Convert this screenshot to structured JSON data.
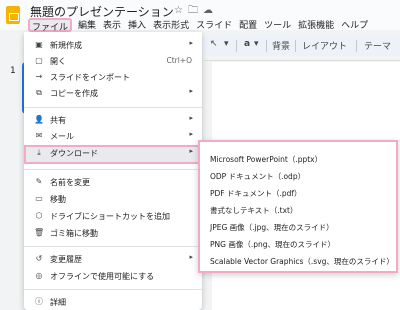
{
  "header": {
    "doc_title": "無題のプレゼンテーション",
    "icons": [
      "star-icon",
      "folder-icon",
      "cloud-icon"
    ]
  },
  "menubar": [
    "ファイル",
    "編集",
    "表示",
    "挿入",
    "表示形式",
    "スライド",
    "配置",
    "ツール",
    "拡張機能",
    "ヘルプ"
  ],
  "toolbar": {
    "shape_glyph": "↖",
    "text_glyph": "a",
    "background": "背景",
    "layout": "レイアウト",
    "theme": "テーマ"
  },
  "slides": {
    "number": "1"
  },
  "file_menu": {
    "items": [
      {
        "label": "新規作成",
        "icon": "new-icon",
        "glyph": "▣",
        "arrow": "▸"
      },
      {
        "label": "開く",
        "icon": "open-icon",
        "glyph": "▢",
        "shortcut": "Ctrl+O"
      },
      {
        "label": "スライドをインポート",
        "icon": "import-icon",
        "glyph": "→"
      },
      {
        "label": "コピーを作成",
        "icon": "copy-icon",
        "glyph": "⧉",
        "arrow": "▸"
      },
      {
        "label": "共有",
        "icon": "share-icon",
        "glyph": "👤",
        "arrow": "▸"
      },
      {
        "label": "メール",
        "icon": "mail-icon",
        "glyph": "✉",
        "arrow": "▸"
      },
      {
        "label": "ダウンロード",
        "icon": "download-icon",
        "glyph": "⤓",
        "arrow": "▸"
      },
      {
        "label": "名前を変更",
        "icon": "rename-icon",
        "glyph": "✎"
      },
      {
        "label": "移動",
        "icon": "move-icon",
        "glyph": "▭"
      },
      {
        "label": "ドライブにショートカットを追加",
        "icon": "shortcut-icon",
        "glyph": "⬡"
      },
      {
        "label": "ゴミ箱に移動",
        "icon": "trash-icon",
        "glyph": "🗑"
      },
      {
        "label": "変更履歴",
        "icon": "history-icon",
        "glyph": "↺",
        "arrow": "▸"
      },
      {
        "label": "オフラインで使用可能にする",
        "icon": "offline-icon",
        "glyph": "◎"
      },
      {
        "label": "詳細",
        "icon": "info-icon",
        "glyph": "ⓘ"
      }
    ]
  },
  "download_submenu": {
    "items": [
      "Microsoft PowerPoint（.pptx）",
      "ODP ドキュメント（.odp）",
      "PDF ドキュメント（.pdf）",
      "書式なしテキスト（.txt）",
      "JPEG 画像（.jpg、現在のスライド）",
      "PNG 画像（.png、現在のスライド）",
      "Scalable Vector Graphics（.svg、現在のスライド）"
    ]
  },
  "colors": {
    "highlight": "#f4a9c6",
    "accent": "#1a73e8",
    "logo": "#f4b400"
  }
}
